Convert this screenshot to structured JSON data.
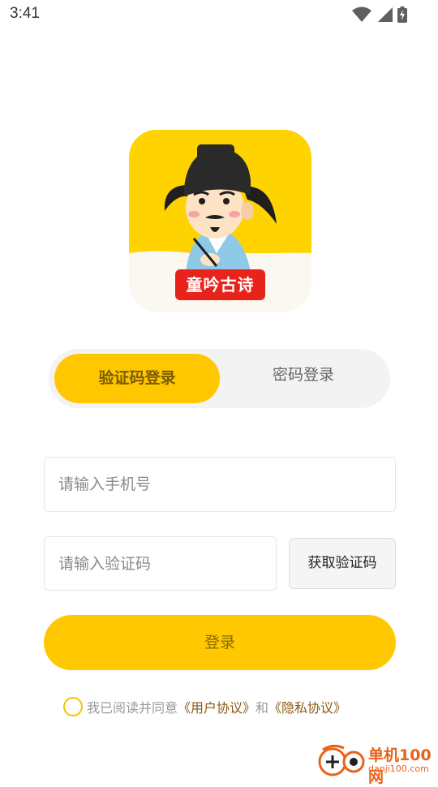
{
  "status_bar": {
    "time": "3:41",
    "icons": [
      "wifi-icon",
      "signal-icon",
      "battery-charging-icon"
    ]
  },
  "app": {
    "logo_label": "童吟古诗",
    "colors": {
      "accent": "#ffc800",
      "logo_bg": "#ffd300",
      "badge_red": "#e8231b"
    }
  },
  "tabs": {
    "active_label": "验证码登录",
    "inactive_label": "密码登录"
  },
  "form": {
    "phone_placeholder": "请输入手机号",
    "code_placeholder": "请输入验证码",
    "get_code_label": "获取验证码",
    "login_label": "登录"
  },
  "agreement": {
    "prefix": "我已阅读并同意",
    "user_agreement": "《用户协议》",
    "conjunction": "和",
    "privacy_agreement": "《隐私协议》"
  },
  "watermark": {
    "name": "单机100网",
    "url": "danji100.com"
  }
}
